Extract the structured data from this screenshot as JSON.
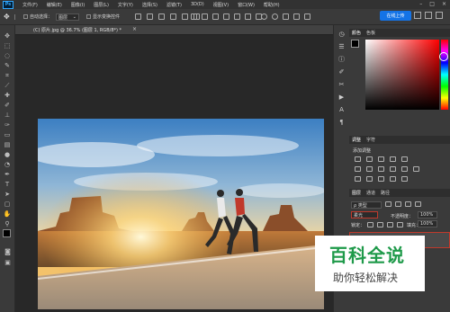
{
  "menubar": {
    "app_logo": "Ps",
    "items": [
      "文件(F)",
      "编辑(E)",
      "图像(I)",
      "图层(L)",
      "文字(Y)",
      "选择(S)",
      "滤镜(T)",
      "3D(D)",
      "视图(V)",
      "窗口(W)",
      "帮助(H)"
    ]
  },
  "options_bar": {
    "auto_select_label": "自动选择：",
    "auto_select_value": "图层",
    "show_transform_label": "显示变换控件",
    "cloud_button": "在线上传"
  },
  "document": {
    "tab_title": "(C) 原片.jpg @ 36.7% (图层 1, RGB/8*) *",
    "tab_close": "×"
  },
  "color_panel": {
    "tabs": [
      "颜色",
      "色板"
    ],
    "accent_colors": {
      "hue_red": "#ff0000",
      "foreground": "#000000",
      "background": "#ffffff"
    }
  },
  "adjustments_panel": {
    "tabs": [
      "调整",
      "字符"
    ],
    "add_label": "添加调整"
  },
  "layers_panel": {
    "tabs": [
      "图层",
      "通道",
      "路径"
    ],
    "filter_label": "ρ 类型",
    "blend_mode": "柔光",
    "opacity_label": "不透明度：",
    "opacity_value": "100%",
    "lock_label": "锁定：",
    "fill_label": "填充：",
    "fill_value": "100%"
  },
  "watermark": {
    "title": "百科全说",
    "subtitle": "助你轻松解决"
  },
  "icons": {
    "toolbar": [
      "move-icon",
      "marquee-icon",
      "lasso-icon",
      "quick-select-icon",
      "crop-icon",
      "eyedropper-icon",
      "healing-icon",
      "brush-icon",
      "stamp-icon",
      "history-brush-icon",
      "eraser-icon",
      "gradient-icon",
      "blur-icon",
      "dodge-icon",
      "pen-icon",
      "type-icon",
      "path-select-icon",
      "shape-icon",
      "hand-icon",
      "zoom-icon",
      "more-icon"
    ]
  }
}
